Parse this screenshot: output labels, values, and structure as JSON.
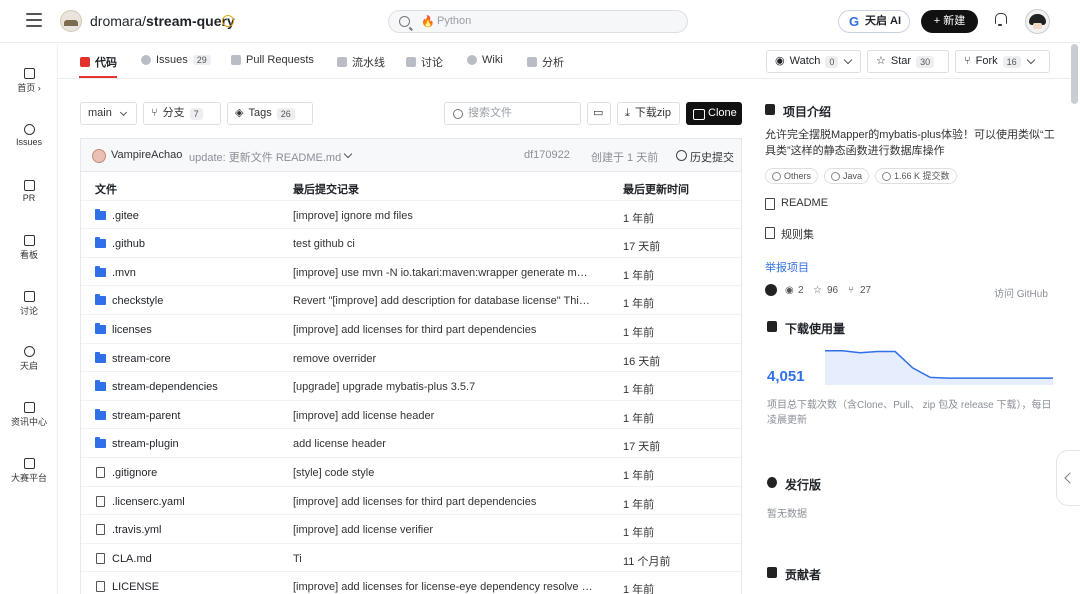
{
  "header": {
    "repo_owner": "dromara",
    "repo_sep": "/",
    "repo_name": "stream-query",
    "search_placeholder": "Python",
    "ai_label": "天启 AI",
    "ai_letter": "G",
    "new_label": "+ 新建"
  },
  "sidebar": {
    "items": [
      {
        "label": "首页 ›"
      },
      {
        "label": "Issues"
      },
      {
        "label": "PR"
      },
      {
        "label": "看板"
      },
      {
        "label": "讨论"
      },
      {
        "label": "天启"
      },
      {
        "label": "资讯中心"
      },
      {
        "label": "大赛平台"
      }
    ]
  },
  "tabs": [
    {
      "label": "代码",
      "count": ""
    },
    {
      "label": "Issues",
      "count": "29"
    },
    {
      "label": "Pull Requests",
      "count": ""
    },
    {
      "label": "流水线",
      "count": ""
    },
    {
      "label": "讨论",
      "count": ""
    },
    {
      "label": "Wiki",
      "count": ""
    },
    {
      "label": "分析",
      "count": ""
    }
  ],
  "actions": {
    "watch_label": "Watch",
    "watch_count": "0",
    "star_label": "Star",
    "star_count": "30",
    "fork_label": "Fork",
    "fork_count": "16"
  },
  "toolbar": {
    "branch": "main",
    "branches_label": "分支",
    "branches_count": "7",
    "tags_label": "Tags",
    "tags_count": "26",
    "file_search_placeholder": "搜索文件",
    "download_label": "下载zip",
    "clone_label": "Clone"
  },
  "commit": {
    "author": "VampireAchao",
    "message": "update: 更新文件 README.md",
    "sha": "df170922",
    "when": "创建于 1 天前",
    "history_label": "历史提交"
  },
  "file_table": {
    "headers": [
      "文件",
      "最后提交记录",
      "最后更新时间"
    ],
    "rows": [
      {
        "type": "folder",
        "name": ".gitee",
        "message": "[improve] ignore md files",
        "time": "1 年前"
      },
      {
        "type": "folder",
        "name": ".github",
        "message": "test github ci",
        "time": "17 天前"
      },
      {
        "type": "folder",
        "name": ".mvn",
        "message": "[improve] use mvn -N io.takari:maven:wrapper generate mvnw...",
        "time": "1 年前"
      },
      {
        "type": "folder",
        "name": "checkstyle",
        "message": "Revert \"[improve] add description for database license\" This r...",
        "time": "1 年前"
      },
      {
        "type": "folder",
        "name": "licenses",
        "message": "[improve] add licenses for third part dependencies",
        "time": "1 年前"
      },
      {
        "type": "folder",
        "name": "stream-core",
        "message": "remove overrider",
        "time": "16 天前"
      },
      {
        "type": "folder",
        "name": "stream-dependencies",
        "message": "[upgrade] upgrade mybatis-plus 3.5.7",
        "time": "1 年前"
      },
      {
        "type": "folder",
        "name": "stream-parent",
        "message": "[improve] add license header",
        "time": "1 年前"
      },
      {
        "type": "folder",
        "name": "stream-plugin",
        "message": "add license header",
        "time": "17 天前"
      },
      {
        "type": "file",
        "name": ".gitignore",
        "message": "[style] code style",
        "time": "1 年前"
      },
      {
        "type": "file",
        "name": ".licenserc.yaml",
        "message": "[improve] add licenses for third part dependencies",
        "time": "1 年前"
      },
      {
        "type": "file",
        "name": ".travis.yml",
        "message": "[improve] add license verifier",
        "time": "1 年前"
      },
      {
        "type": "file",
        "name": "CLA.md",
        "message": "Ti",
        "time": "11 个月前"
      },
      {
        "type": "file",
        "name": "LICENSE",
        "message": "[improve] add licenses for license-eye dependency resolve --...",
        "time": "1 年前"
      }
    ]
  },
  "about": {
    "title": "项目介绍",
    "description": "允许完全摆脱Mapper的mybatis-plus体验！可以使用类似“工具类”这样的静态函数进行数据库操作",
    "tags": [
      "Others",
      "Java",
      "1.66 K 提交数"
    ],
    "readme_label": "README",
    "rules_label": "规则集",
    "report_label": "举报项目",
    "watchers": "2",
    "stars": "96",
    "forks": "27",
    "visit_github": "访问 GitHub"
  },
  "downloads": {
    "title": "下载使用量",
    "total": "4,051",
    "description": "项目总下载次数（含Clone、Pull、 zip 包及 release 下载），每日凌晨更新"
  },
  "chart_data": {
    "type": "area",
    "values": [
      90,
      90,
      85,
      88,
      88,
      45,
      20,
      18,
      18,
      18,
      18,
      18,
      18,
      18
    ],
    "ylim": [
      0,
      100
    ],
    "color": "#2f6fe8"
  },
  "releases": {
    "title": "发行版",
    "empty": "暂无数据"
  },
  "contributors": {
    "title": "贡献者"
  }
}
